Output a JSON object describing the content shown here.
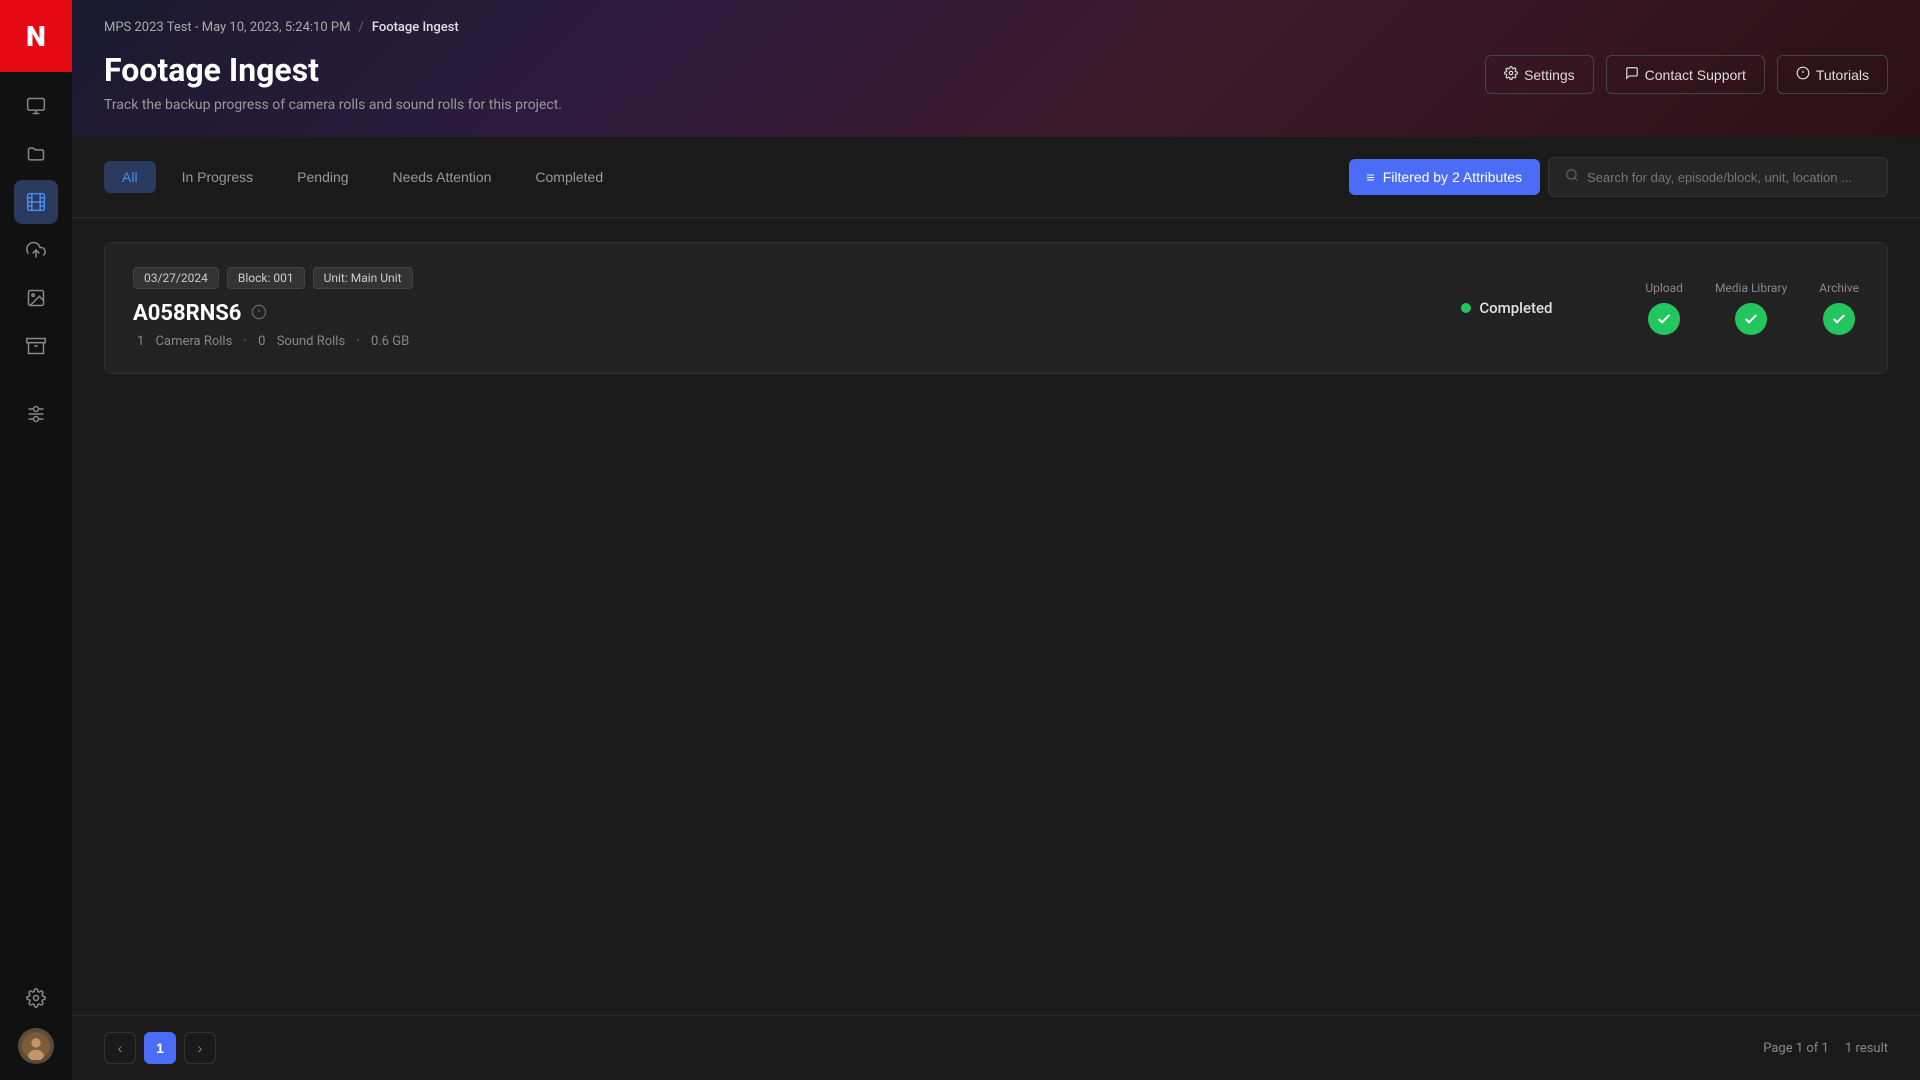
{
  "app": {
    "logo": "N"
  },
  "sidebar": {
    "items": [
      {
        "id": "monitor",
        "icon": "▣",
        "active": false
      },
      {
        "id": "folder",
        "icon": "🗂",
        "active": false
      },
      {
        "id": "footage",
        "icon": "▤",
        "active": true
      },
      {
        "id": "upload",
        "icon": "⬆",
        "active": false
      },
      {
        "id": "media",
        "icon": "◧",
        "active": false
      },
      {
        "id": "archive",
        "icon": "⧉",
        "active": false
      }
    ],
    "bottom": [
      {
        "id": "settings",
        "icon": "⚙"
      }
    ],
    "avatar_text": "👤"
  },
  "breadcrumb": {
    "project": "MPS 2023 Test - May 10, 2023, 5:24:10 PM",
    "separator": "/",
    "current": "Footage Ingest"
  },
  "header": {
    "title": "Footage Ingest",
    "subtitle": "Track the backup progress of camera rolls and sound rolls for this project.",
    "buttons": [
      {
        "id": "settings",
        "icon": "⚙",
        "label": "Settings"
      },
      {
        "id": "contact-support",
        "icon": "💬",
        "label": "Contact Support"
      },
      {
        "id": "tutorials",
        "icon": "ℹ",
        "label": "Tutorials"
      }
    ]
  },
  "tabs": [
    {
      "id": "all",
      "label": "All",
      "active": true
    },
    {
      "id": "in-progress",
      "label": "In Progress",
      "active": false
    },
    {
      "id": "pending",
      "label": "Pending",
      "active": false
    },
    {
      "id": "needs-attention",
      "label": "Needs Attention",
      "active": false
    },
    {
      "id": "completed",
      "label": "Completed",
      "active": false
    }
  ],
  "filter": {
    "label": "Filtered by 2 Attributes",
    "icon": "≡"
  },
  "search": {
    "placeholder": "Search for day, episode/block, unit, location ..."
  },
  "rolls": [
    {
      "id": "A058RNS6",
      "date": "03/27/2024",
      "block": "Block: 001",
      "unit": "Unit: Main Unit",
      "name": "A058RNS6",
      "camera_rolls": "1",
      "sound_rolls": "0",
      "size": "0.6 GB",
      "status": "Completed",
      "status_color": "#22c55e",
      "pipeline": {
        "upload": {
          "label": "Upload",
          "done": true
        },
        "media_library": {
          "label": "Media Library",
          "done": true
        },
        "archive": {
          "label": "Archive",
          "done": true
        }
      }
    }
  ],
  "roll_meta_template": {
    "camera_rolls_label": "Camera Rolls",
    "sound_rolls_label": "Sound Rolls"
  },
  "pagination": {
    "current_page": 1,
    "total_pages": 1,
    "page_info": "Page 1 of 1",
    "result_count": "1 result"
  }
}
